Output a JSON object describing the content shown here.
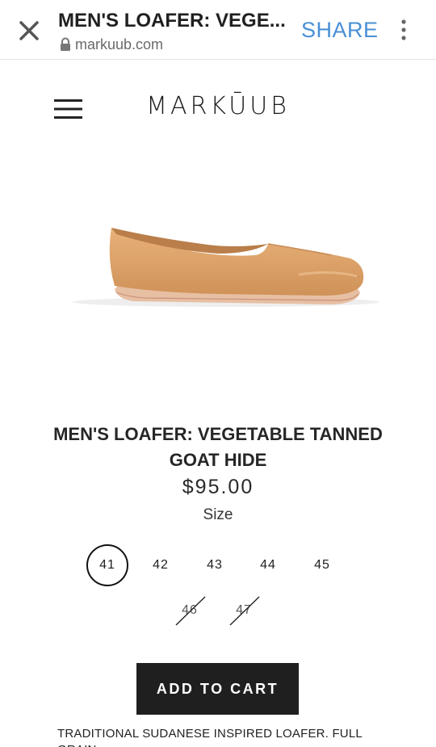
{
  "browser": {
    "page_title": "MEN'S LOAFER: VEGE...",
    "url": "markuub.com",
    "share_label": "SHARE"
  },
  "site": {
    "brand": "MARKUUB",
    "brand_display": "MARKŪUB"
  },
  "product": {
    "title": "MEN'S LOAFER: VEGETABLE TANNED GOAT HIDE",
    "price": "$95.00",
    "size_label": "Size",
    "sizes": [
      {
        "label": "41",
        "selected": true,
        "available": true
      },
      {
        "label": "42",
        "selected": false,
        "available": true
      },
      {
        "label": "43",
        "selected": false,
        "available": true
      },
      {
        "label": "44",
        "selected": false,
        "available": true
      },
      {
        "label": "45",
        "selected": false,
        "available": true
      },
      {
        "label": "46",
        "selected": false,
        "available": false
      },
      {
        "label": "47",
        "selected": false,
        "available": false
      }
    ],
    "add_to_cart_label": "ADD TO CART",
    "description": "TRADITIONAL SUDANESE INSPIRED LOAFER. FULL GRAIN"
  },
  "colors": {
    "share": "#4a8fd6",
    "button_bg": "#1f1f1f",
    "button_text": "#ffffff",
    "leather": "#d9a06a"
  },
  "icons": {
    "close": "close-icon",
    "lock": "lock-icon",
    "more": "more-vertical-icon",
    "menu": "hamburger-menu-icon"
  }
}
